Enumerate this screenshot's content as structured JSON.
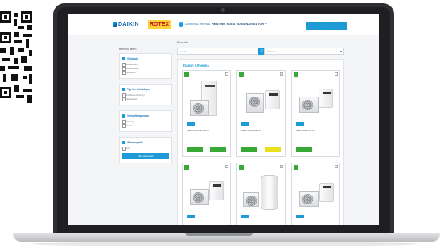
{
  "header": {
    "brand_daikin": "DAIKIN",
    "brand_rotex": "ROTEX",
    "brand_altherma": "DAIKIN ALTHERMA",
    "nav_title": "HEATING SOLUTIONS NAVIGATOR™",
    "action_button": "…"
  },
  "filters": {
    "heading": "Bereich filtern",
    "groups": [
      {
        "title": "Gebäude",
        "options": [
          "Einfamilien",
          "Mehrfamilien",
          "Gewerbe"
        ]
      },
      {
        "title": "Typ der Heizkörper",
        "options": [
          "Fußbodenheizung",
          "Heizkörper"
        ]
      },
      {
        "title": "Vorlauftemperatur",
        "options": [
          "Niedrig",
          "Hoch"
        ]
      },
      {
        "title": "Wärmequelle",
        "options": [
          "Luft"
        ]
      }
    ],
    "apply_label": "Filter anwenden"
  },
  "main": {
    "heading": "Produkte",
    "search_placeholder": "Suche…",
    "sort_value": "Sortieren",
    "section_title": "Daikin Altherma",
    "cards": [
      {
        "name": "Daikin Altherma 3 H HT",
        "price": "",
        "energy": "",
        "energy_color": "#39a935"
      },
      {
        "name": "Daikin Altherma 3 H",
        "price": "",
        "energy": "",
        "energy_color": "#e8e01a"
      },
      {
        "name": "Daikin Altherma 3 R",
        "price": "",
        "energy": "",
        "energy_color": "#39a935"
      },
      {
        "name": "",
        "price": "",
        "energy": "",
        "energy_color": "#39a935"
      },
      {
        "name": "",
        "price": "",
        "energy": "",
        "energy_color": "#39a935"
      },
      {
        "name": "",
        "price": "",
        "energy": "",
        "energy_color": "#39a935"
      }
    ]
  },
  "colors": {
    "accent": "#1e9bd7",
    "energy_green": "#39a935",
    "energy_yellow": "#e8e01a",
    "rotex_yellow": "#ffd23a"
  }
}
